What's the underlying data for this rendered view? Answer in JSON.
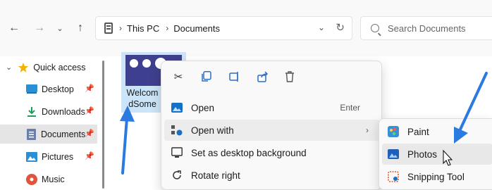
{
  "address_bar": {
    "crumbs": [
      "This PC",
      "Documents"
    ]
  },
  "search": {
    "placeholder": "Search Documents"
  },
  "sidebar": {
    "items": [
      {
        "label": "Quick access",
        "icon": "star-icon"
      },
      {
        "label": "Desktop",
        "icon": "desktop-folder-icon",
        "pinned": true
      },
      {
        "label": "Downloads",
        "icon": "download-icon",
        "pinned": true
      },
      {
        "label": "Documents",
        "icon": "documents-icon",
        "pinned": true,
        "selected": true
      },
      {
        "label": "Pictures",
        "icon": "pictures-icon",
        "pinned": true
      },
      {
        "label": "Music",
        "icon": "music-icon"
      }
    ]
  },
  "file": {
    "name_line1": "Welcom",
    "name_line2": "dSome"
  },
  "context_menu": {
    "toolbar_icons": [
      "cut-icon",
      "copy-icon",
      "rename-icon",
      "share-icon",
      "delete-icon"
    ],
    "items": [
      {
        "label": "Open",
        "shortcut": "Enter",
        "icon": "photo-icon"
      },
      {
        "label": "Open with",
        "icon": "open-with-icon",
        "has_submenu": true
      },
      {
        "label": "Set as desktop background",
        "icon": "desktop-background-icon"
      },
      {
        "label": "Rotate right",
        "icon": "rotate-right-icon"
      }
    ]
  },
  "open_with_submenu": {
    "items": [
      {
        "label": "Paint",
        "icon": "paint-icon"
      },
      {
        "label": "Photos",
        "icon": "photos-icon",
        "hovered": true
      },
      {
        "label": "Snipping Tool",
        "icon": "snipping-tool-icon"
      }
    ]
  },
  "colors": {
    "accent": "#0067c0",
    "annotation_arrow": "#2a7ae2",
    "selection": "#cce4f7"
  }
}
